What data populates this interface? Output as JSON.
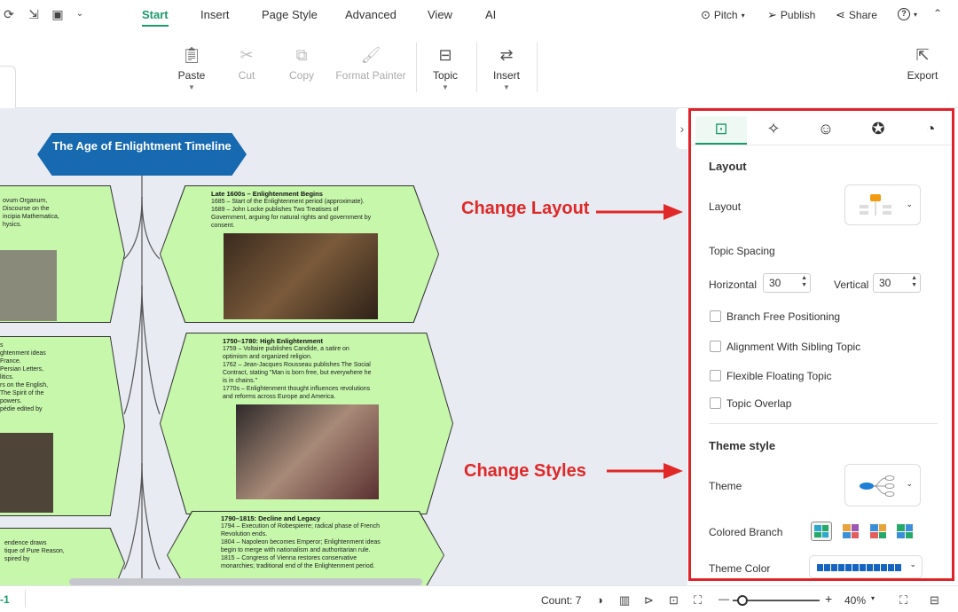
{
  "menubar": {
    "tabs": [
      {
        "label": "Start",
        "active": true
      },
      {
        "label": "Insert"
      },
      {
        "label": "Page Style"
      },
      {
        "label": "Advanced"
      },
      {
        "label": "View"
      },
      {
        "label": "AI"
      }
    ],
    "pitch": "Pitch",
    "publish": "Publish",
    "share": "Share",
    "help": "?"
  },
  "toolbar": {
    "paste": "Paste",
    "cut": "Cut",
    "copy": "Copy",
    "format_painter": "Format Painter",
    "topic": "Topic",
    "insert": "Insert",
    "export": "Export"
  },
  "canvas": {
    "root": "The Age of Enlightment Timeline",
    "nodes": [
      {
        "title": "Late 1600s – Enlightenment Begins",
        "lines": [
          "1685 – Start of the Enlightenment period (approximate).",
          "1689 – John Locke publishes Two Treatises of",
          "Government, arguing for natural rights and government by",
          "consent."
        ]
      },
      {
        "title": "1750–1780: High Enlightenment",
        "lines": [
          "1759 – Voltaire publishes Candide, a satire on",
          "optimism and organized religion.",
          "1762 – Jean-Jacques Rousseau publishes The Social",
          "Contract, stating \"Man is born free, but everywhere he",
          "is in chains.\"",
          "1770s – Enlightenment thought influences revolutions",
          "and reforms across Europe and America."
        ]
      },
      {
        "title": "1790–1815: Decline and Legacy",
        "lines": [
          "1794 – Execution of Robespierre; radical phase of French",
          "Revolution ends.",
          "1804 – Napoleon becomes Emperor; Enlightenment ideas",
          "begin to merge with nationalism and authoritarian rule.",
          "1815 – Congress of Vienna restores conservative",
          "monarchies; traditional end of the Enlightenment period."
        ]
      }
    ],
    "left_partial": [
      [
        "ovum Organum,",
        "Discourse on the",
        "",
        "incipia Mathematica,",
        "hysics."
      ],
      [
        "s",
        "ghtenment ideas",
        "France.",
        "Persian Letters,",
        "litics.",
        "rs on the English,",
        "",
        "The Spirit of the",
        "powers.",
        "pédie edited by"
      ],
      [
        "endence draws",
        "",
        "tique of Pure Reason,",
        "spired by"
      ]
    ],
    "annotations": {
      "layout": "Change Layout",
      "styles": "Change Styles"
    }
  },
  "panel": {
    "tabs": [
      "layout-tab",
      "ai-tab",
      "emoji-tab",
      "badge-tab",
      "history-tab"
    ],
    "layout_heading": "Layout",
    "layout_label": "Layout",
    "topic_spacing": "Topic Spacing",
    "horizontal_label": "Horizontal",
    "horizontal_value": "30",
    "vertical_label": "Vertical",
    "vertical_value": "30",
    "options": [
      {
        "label": "Branch Free Positioning",
        "checked": false
      },
      {
        "label": "Alignment With Sibling Topic",
        "checked": false
      },
      {
        "label": "Flexible Floating Topic",
        "checked": false
      },
      {
        "label": "Topic Overlap",
        "checked": false
      }
    ],
    "theme_heading": "Theme style",
    "theme_label": "Theme",
    "colored_branch_label": "Colored Branch",
    "theme_color_label": "Theme Color"
  },
  "statusbar": {
    "page": "-1",
    "count": "Count: 7",
    "zoom_minus": "—",
    "zoom_plus": "+",
    "zoom": "40%"
  },
  "colors": {
    "accent": "#1a9a6a",
    "root_fill": "#1769b0",
    "node_fill": "#c6f7ab",
    "annotation": "#e02828",
    "canvas_bg": "#e8ebf2"
  }
}
